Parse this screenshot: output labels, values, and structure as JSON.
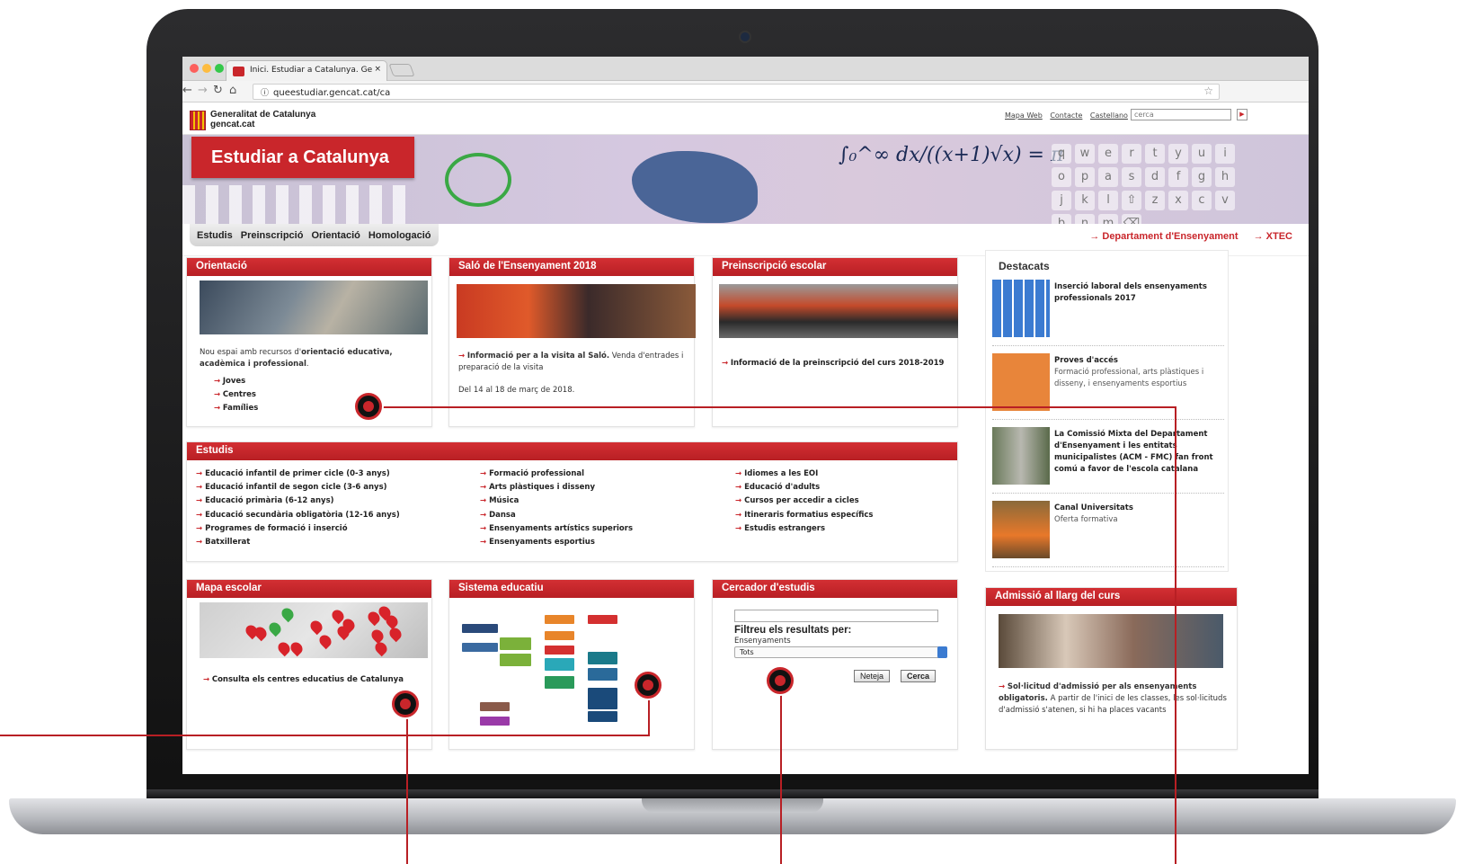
{
  "browser": {
    "tab_title": "Inici. Estudiar a Catalunya. Ge",
    "tab_close": "×",
    "url": "queestudiar.gencat.cat/ca",
    "nav_icons": [
      "back-icon",
      "forward-icon",
      "reload-icon",
      "home-icon",
      "info-icon"
    ],
    "star": "☆"
  },
  "site": {
    "brand_line1": "Generalitat de Catalunya",
    "brand_line2": "gencat.cat",
    "top_links": [
      "Mapa Web",
      "Contacte",
      "Castellano"
    ],
    "search_placeholder": "cerca",
    "search_button": "▶"
  },
  "banner": {
    "title": "Estudiar a Catalunya",
    "formula": "∫₀^∞ dx/((x+1)√x) = π",
    "keys": [
      "q",
      "w",
      "e",
      "r",
      "t",
      "y",
      "u",
      "i",
      "o",
      "p",
      "a",
      "s",
      "d",
      "f",
      "g",
      "h",
      "j",
      "k",
      "l",
      "⇧",
      "z",
      "x",
      "c",
      "v",
      "b",
      "n",
      "m",
      "⌫"
    ]
  },
  "nav": {
    "menu": [
      "Estudis",
      "Preinscripció",
      "Orientació",
      "Homologació"
    ],
    "dept_links": [
      "→ Departament d'Ensenyament",
      "→ XTEC"
    ]
  },
  "orientacio": {
    "title": "Orientació",
    "intro_pre": "Nou espai amb recursos d'",
    "intro_bold": "orientació educativa, acadèmica i professional",
    "intro_post": ".",
    "links": [
      "Joves",
      "Centres",
      "Famílies"
    ]
  },
  "salo": {
    "title": "Saló de l'Ensenyament 2018",
    "link_bold": "Informació per a la visita al Saló.",
    "link_rest": " Venda d'entrades i preparació de la visita",
    "dates": "Del 14 al 18 de març de 2018."
  },
  "preinscripcio": {
    "title": "Preinscripció escolar",
    "link": "Informació de la preinscripció del curs 2018-2019"
  },
  "estudis": {
    "title": "Estudis",
    "col1": [
      "Educació infantil de primer cicle (0-3 anys)",
      "Educació infantil de segon cicle (3-6 anys)",
      "Educació primària (6-12 anys)",
      "Educació secundària obligatòria (12-16 anys)",
      "Programes de formació i inserció",
      "Batxillerat"
    ],
    "col2": [
      "Formació professional",
      "Arts plàstiques i disseny",
      "Música",
      "Dansa",
      "Ensenyaments artístics superiors",
      "Ensenyaments esportius"
    ],
    "col3": [
      "Idiomes a les EOI",
      "Educació d'adults",
      "Cursos per accedir a cicles",
      "Itineraris formatius específics",
      "Estudis estrangers"
    ]
  },
  "mapa": {
    "title": "Mapa escolar",
    "link": "Consulta els centres educatius de Catalunya"
  },
  "sistema": {
    "title": "Sistema educatiu"
  },
  "cercador": {
    "title": "Cercador d'estudis",
    "filter_heading": "Filtreu els resultats per:",
    "filter_label": "Ensenyaments",
    "select_value": "Tots",
    "clear_button": "Neteja",
    "search_button": "Cerca"
  },
  "destacats": {
    "title": "Destacats",
    "items": [
      {
        "title": "Inserció laboral dels ensenyaments professionals 2017",
        "text": ""
      },
      {
        "title": "Proves d'accés",
        "text": "Formació professional, arts plàstiques i disseny, i ensenyaments esportius"
      },
      {
        "title": "La Comissió Mixta del Departament d'Ensenyament i les entitats municipalistes (ACM - FMC) fan front comú a favor de l'escola catalana",
        "text": ""
      },
      {
        "title": "Canal Universitats",
        "text": "Oferta formativa"
      }
    ]
  },
  "admissio": {
    "title": "Admissió al llarg del curs",
    "link_bold": "Sol·licitud d'admissió per als ensenyaments obligatoris.",
    "text": " A partir de l'inici de les classes, les sol·licituds d'admissió s'atenen, si hi ha places vacants"
  },
  "colors": {
    "brand_red": "#c9262b",
    "green_circle": "#3aa845"
  }
}
